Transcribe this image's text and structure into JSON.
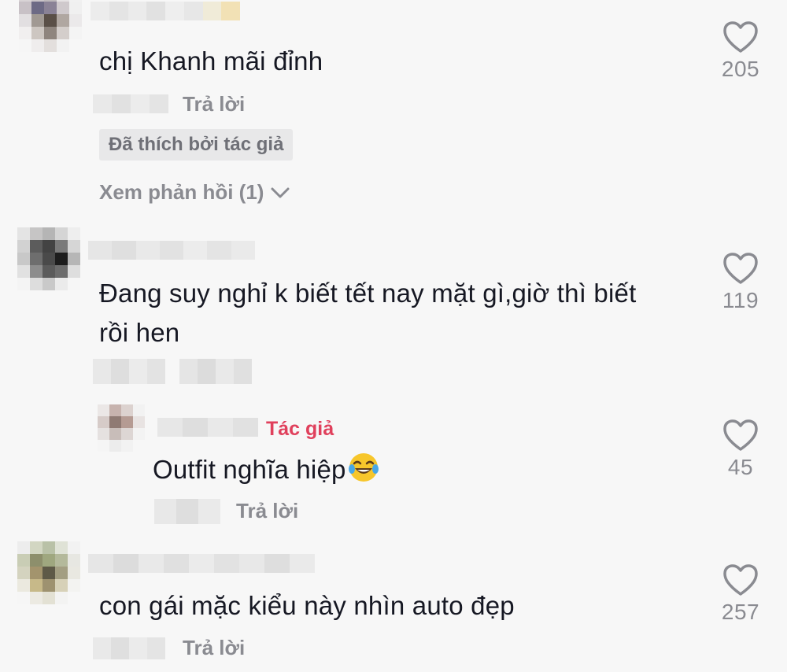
{
  "comments": [
    {
      "text": "chị Khanh mãi đỉnh",
      "reply_label": "Trả lời",
      "liked_by_author": "Đã thích bởi tác giả",
      "view_replies": "Xem phản hồi (1)",
      "like_count": "205"
    },
    {
      "text_line1": "Đang suy nghỉ k biết tết nay mặt gì,giờ thì biết",
      "text_line2": "rồi hen",
      "like_count": "119",
      "reply": {
        "author_tag": "Tác giả",
        "text": "Outfit nghĩa hiệp",
        "emoji": "face-with-tears-of-joy",
        "reply_label": "Trả lời",
        "like_count": "45"
      }
    },
    {
      "text": "con gái mặc kiểu này nhìn auto đẹp",
      "reply_label": "Trả lời",
      "like_count": "257"
    }
  ],
  "colors": {
    "background": "#f7f7f7",
    "text": "#161823",
    "secondary_text": "#8a8b91",
    "author_tag": "#e0405c",
    "badge_bg": "#e8e8e9"
  },
  "icons": {
    "like": "heart-outline-icon",
    "expand": "chevron-down-icon"
  }
}
